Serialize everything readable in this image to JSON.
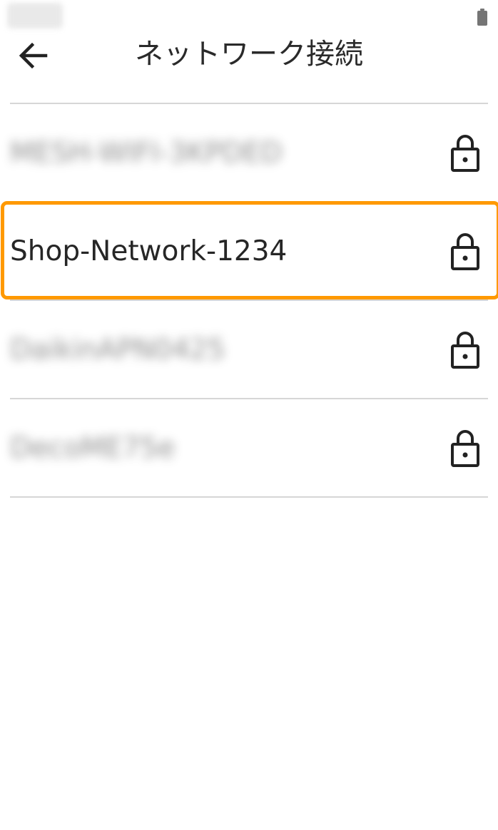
{
  "status_bar": {
    "time_icon": "blurred-time",
    "battery_icon": "battery-icon"
  },
  "header": {
    "back_icon": "arrow-left-icon",
    "title": "ネットワーク接続"
  },
  "networks": [
    {
      "name": "MESH-WIFI-3KPDED",
      "blurred": true,
      "icon": "lock-icon"
    },
    {
      "name": "Shop-Network-1234",
      "blurred": false,
      "icon": "lock-icon",
      "highlighted": true
    },
    {
      "name": "DaikinAPN0425",
      "blurred": true,
      "icon": "lock-icon"
    },
    {
      "name": "DecoME75e",
      "blurred": true,
      "icon": "lock-icon"
    }
  ],
  "colors": {
    "highlight": "#ff9900",
    "divider": "#d6d6d6",
    "text": "#262626"
  }
}
